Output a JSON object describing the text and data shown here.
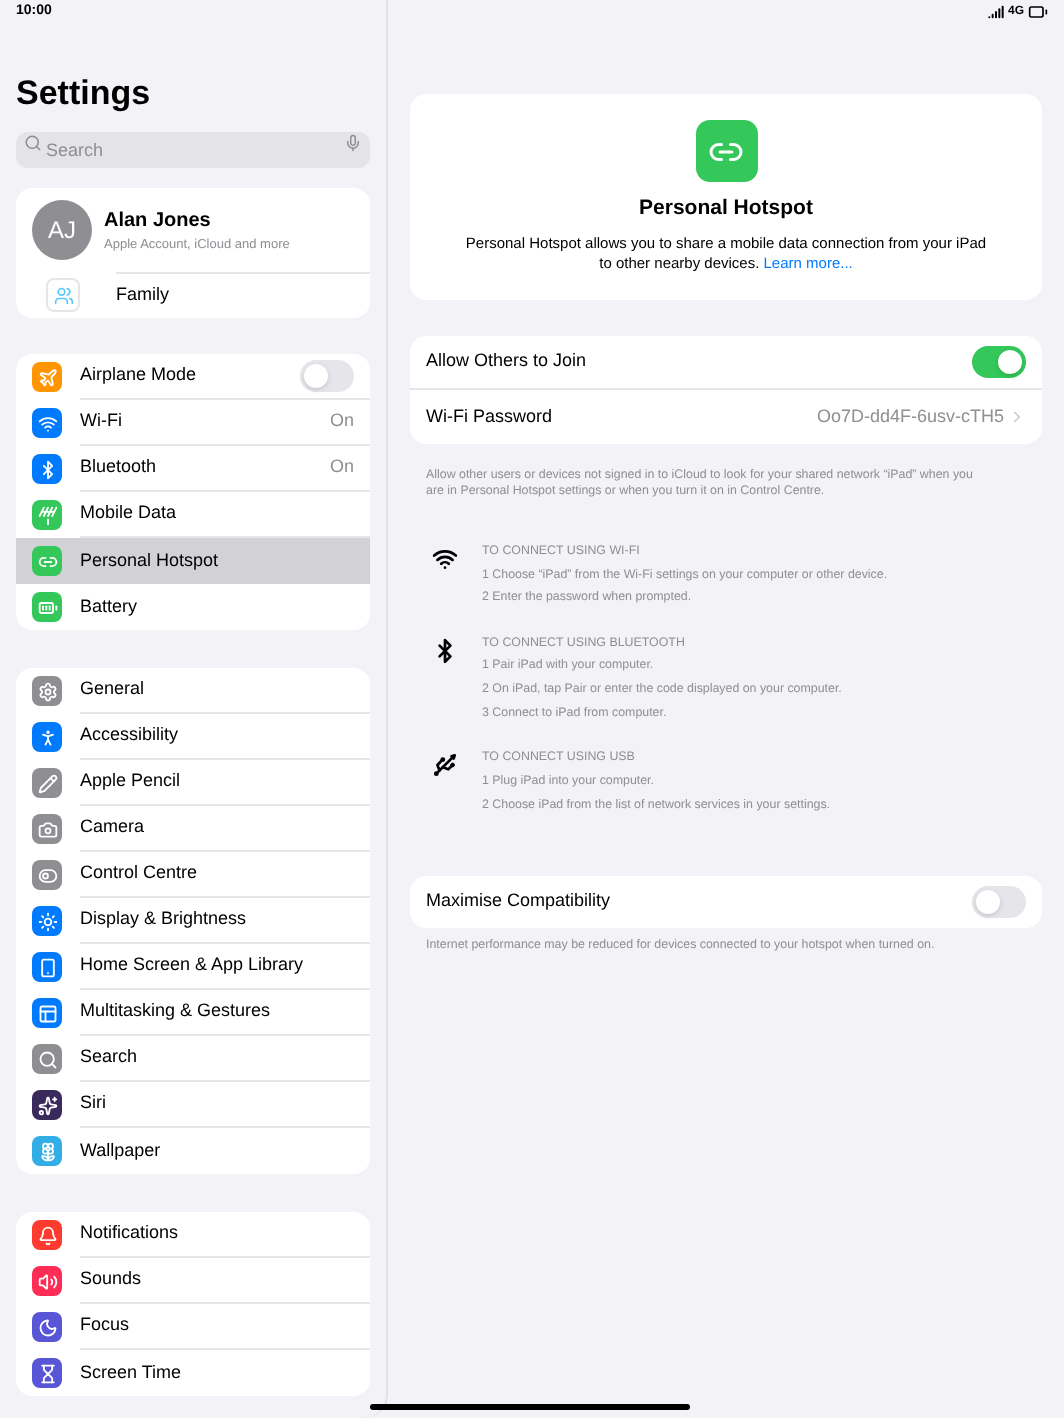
{
  "status_bar": {
    "time": "10:00",
    "network": "4G"
  },
  "sidebar": {
    "title": "Settings",
    "search": {
      "placeholder": "Search"
    },
    "profile": {
      "initials": "AJ",
      "name": "Alan Jones",
      "subtitle": "Apple Account, iCloud and more",
      "family": "Family"
    },
    "groups": [
      {
        "items": [
          {
            "label": "Airplane Mode",
            "color": "#ff9500",
            "kind": "toggle",
            "on": false,
            "selected": false
          },
          {
            "label": "Wi-Fi",
            "color": "#007aff",
            "kind": "value",
            "value": "On",
            "selected": false
          },
          {
            "label": "Bluetooth",
            "color": "#007aff",
            "kind": "value",
            "value": "On",
            "selected": false
          },
          {
            "label": "Mobile Data",
            "color": "#34c759",
            "kind": "link",
            "selected": false
          },
          {
            "label": "Personal Hotspot",
            "color": "#34c759",
            "kind": "link",
            "selected": true
          },
          {
            "label": "Battery",
            "color": "#34c759",
            "kind": "link",
            "selected": false
          }
        ]
      },
      {
        "items": [
          {
            "label": "General",
            "color": "#8e8e93",
            "kind": "link",
            "selected": false
          },
          {
            "label": "Accessibility",
            "color": "#007aff",
            "kind": "link",
            "selected": false
          },
          {
            "label": "Apple Pencil",
            "color": "#8e8e93",
            "kind": "link",
            "selected": false
          },
          {
            "label": "Camera",
            "color": "#8e8e93",
            "kind": "link",
            "selected": false
          },
          {
            "label": "Control Centre",
            "color": "#8e8e93",
            "kind": "link",
            "selected": false
          },
          {
            "label": "Display & Brightness",
            "color": "#007aff",
            "kind": "link",
            "selected": false
          },
          {
            "label": "Home Screen & App Library",
            "color": "#007aff",
            "kind": "link",
            "selected": false
          },
          {
            "label": "Multitasking & Gestures",
            "color": "#007aff",
            "kind": "link",
            "selected": false
          },
          {
            "label": "Search",
            "color": "#8e8e93",
            "kind": "link",
            "selected": false
          },
          {
            "label": "Siri",
            "color": "#3a2a5c",
            "kind": "link",
            "selected": false
          },
          {
            "label": "Wallpaper",
            "color": "#32ade6",
            "kind": "link",
            "selected": false
          }
        ]
      },
      {
        "items": [
          {
            "label": "Notifications",
            "color": "#ff3b30",
            "kind": "link",
            "selected": false
          },
          {
            "label": "Sounds",
            "color": "#ff2d55",
            "kind": "link",
            "selected": false
          },
          {
            "label": "Focus",
            "color": "#5856d6",
            "kind": "link",
            "selected": false
          },
          {
            "label": "Screen Time",
            "color": "#5856d6",
            "kind": "link",
            "selected": false
          }
        ]
      }
    ]
  },
  "detail": {
    "header": {
      "title": "Personal Hotspot",
      "description": "Personal Hotspot allows you to share a mobile data connection from your iPad to other nearby devices.",
      "link": "Learn more..."
    },
    "settings": [
      {
        "label": "Allow Others to Join",
        "kind": "toggle",
        "on": true
      },
      {
        "label": "Wi-Fi Password",
        "kind": "value",
        "value": "Oo7D-dd4F-6usv-cTH5"
      }
    ],
    "footnote": "Allow other users or devices not signed in to iCloud to look for your shared network “iPad” when you are in Personal Hotspot settings or when you turn it on in Control Centre.",
    "instructions": [
      {
        "heading": "TO CONNECT USING WI-FI",
        "steps": [
          "1 Choose “iPad” from the Wi-Fi settings on your computer or other device.",
          "2 Enter the password when prompted."
        ]
      },
      {
        "heading": "TO CONNECT USING BLUETOOTH",
        "steps": [
          "1 Pair iPad with your computer.",
          "2 On iPad, tap Pair or enter the code displayed on your computer.",
          "3 Connect to iPad from computer."
        ]
      },
      {
        "heading": "TO CONNECT USING USB",
        "steps": [
          "1 Plug iPad into your computer.",
          "2 Choose iPad from the list of network services in your settings."
        ]
      }
    ],
    "compat": {
      "label": "Maximise Compatibility",
      "on": false
    },
    "compat_note": "Internet performance may be reduced for devices connected to your hotspot when turned on."
  }
}
